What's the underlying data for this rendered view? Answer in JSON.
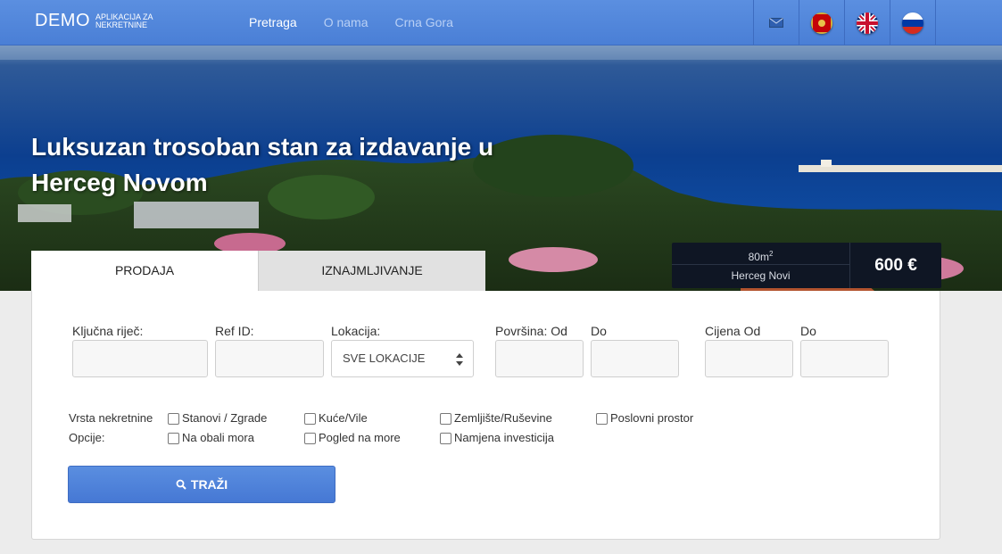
{
  "brand": {
    "name": "DEMO",
    "tagline": "APLIKACIJA ZA NEKRETNINE"
  },
  "nav": {
    "links": [
      {
        "label": "Pretraga",
        "active": true
      },
      {
        "label": "O nama",
        "active": false
      },
      {
        "label": "Crna Gora",
        "active": false
      }
    ],
    "icons": [
      "mail-icon",
      "montenegro-flag-icon",
      "uk-flag-icon",
      "russia-flag-icon"
    ]
  },
  "hero": {
    "title": "Luksuzan trosoban stan za izdavanje u Herceg Novom",
    "area_value": "80m",
    "area_unit_sup": "2",
    "city": "Herceg Novi",
    "price": "600 €"
  },
  "tabs": [
    {
      "label": "PRODAJA",
      "active": true
    },
    {
      "label": "IZNAJMLJIVANJE",
      "active": false
    }
  ],
  "search": {
    "fields": {
      "keyword": {
        "label": "Ključna riječ:",
        "value": ""
      },
      "ref_id": {
        "label": "Ref ID:",
        "value": ""
      },
      "location": {
        "label": "Lokacija:",
        "selected": "SVE LOKACIJE"
      },
      "area_from": {
        "label": "Površina: Od",
        "value": ""
      },
      "area_to": {
        "label": "Do",
        "value": ""
      },
      "price_from": {
        "label": "Cijena Od",
        "value": ""
      },
      "price_to": {
        "label": "Do",
        "value": ""
      }
    },
    "property_type_label": "Vrsta nekretnine",
    "property_types": [
      "Stanovi / Zgrade",
      "Kuće/Vile",
      "Zemljište/Ruševine",
      "Poslovni prostor"
    ],
    "options_label": "Opcije:",
    "options": [
      "Na obali mora",
      "Pogled na more",
      "Namjena investicija"
    ],
    "button_label": "TRAŽI"
  },
  "colors": {
    "accent": "#4a7fd6",
    "price_box": "#0f1624"
  }
}
